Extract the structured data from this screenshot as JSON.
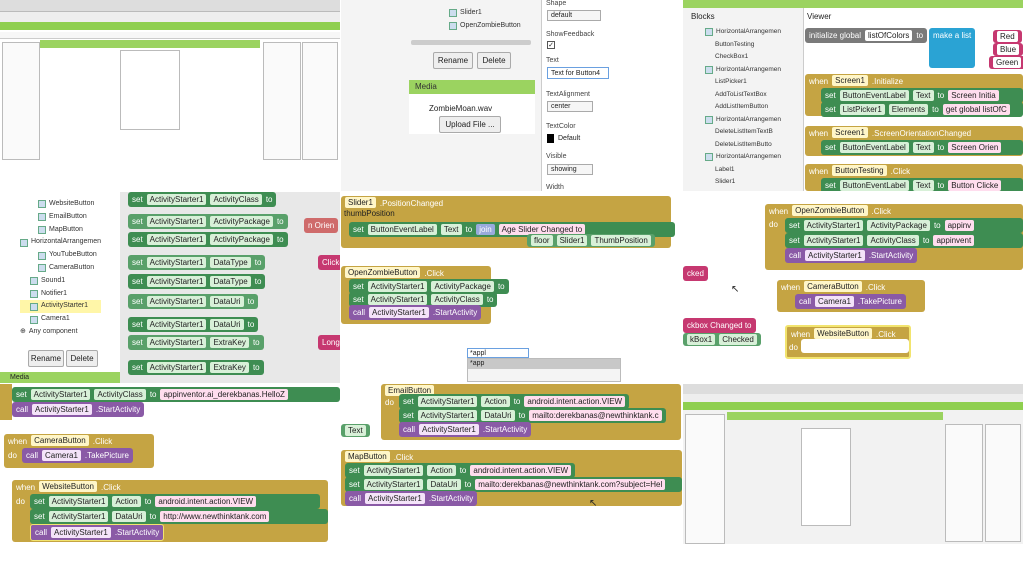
{
  "cell2": {
    "tree_items": [
      "Slider1",
      "OpenZombieButton"
    ],
    "rename": "Rename",
    "delete": "Delete",
    "media_title": "Media",
    "media_file": "ZombieMoan.wav",
    "upload": "Upload File ...",
    "props": {
      "shape_label": "Shape",
      "shape_value": "default",
      "show_feedback": "ShowFeedback",
      "text_label": "Text",
      "text_value": "Text for Button4",
      "align_label": "TextAlignment",
      "align_value": "center",
      "color_label": "TextColor",
      "color_value": "Default",
      "visible_label": "Visible",
      "visible_value": "showing",
      "width_label": "Width"
    }
  },
  "cell3": {
    "blocks_title": "Blocks",
    "viewer_title": "Viewer",
    "tree": [
      "HorizontalArrangemen",
      "ButtonTesting",
      "CheckBox1",
      "HorizontalArrangemen",
      "ListPicker1",
      "AddToListTextBox",
      "AddListItemButton",
      "HorizontalArrangemen",
      "DeleteListItemTextB",
      "DeleteListItemButto",
      "HorizontalArrangemen",
      "Label1",
      "Slider1"
    ],
    "init": {
      "a": "initialize global",
      "b": "listOfColors",
      "c": "to",
      "d": "make a list",
      "e": [
        "Red",
        "Blue",
        "Green"
      ]
    },
    "ev1": {
      "when": "when",
      "comp": "Screen1",
      "ev": ".Initialize"
    },
    "set1": {
      "set": "set",
      "comp": "ButtonEventLabel",
      "prop": "Text",
      "to": "to",
      "val": "Screen Initia"
    },
    "set2": {
      "set": "set",
      "comp": "ListPicker1",
      "prop": "Elements",
      "to": "to",
      "val": "get global listOfC"
    },
    "ev2": {
      "when": "when",
      "comp": "Screen1",
      "ev": ".ScreenOrientationChanged"
    },
    "set3": {
      "set": "set",
      "comp": "ButtonEventLabel",
      "prop": "Text",
      "to": "to",
      "val": "Screen Orien"
    },
    "ev3": {
      "when": "when",
      "comp": "ButtonTesting",
      "ev": ".Click"
    },
    "set4": {
      "set": "set",
      "comp": "ButtonEventLabel",
      "prop": "Text",
      "to": "to",
      "val": "Button Clicke"
    },
    "do": "do"
  },
  "cell4": {
    "tree": [
      "WebsiteButton",
      "EmailButton",
      "MapButton",
      "HorizontalArrangemen",
      "YouTubeButton",
      "CameraButton",
      "Sound1",
      "Notifier1",
      "ActivityStarter1",
      "Camera1",
      "Any component"
    ],
    "rename": "Rename",
    "delete": "Delete",
    "media": "Media",
    "blocks": [
      {
        "comp": "ActivityStarter1",
        "prop": "ActivityClass"
      },
      {
        "comp": "ActivityStarter1",
        "prop": "ActivityPackage"
      },
      {
        "comp": "ActivityStarter1",
        "prop": "ActivityPackage"
      },
      {
        "comp": "ActivityStarter1",
        "prop": "DataType"
      },
      {
        "comp": "ActivityStarter1",
        "prop": "DataType"
      },
      {
        "comp": "ActivityStarter1",
        "prop": "DataUri"
      },
      {
        "comp": "ActivityStarter1",
        "prop": "DataUri"
      },
      {
        "comp": "ActivityStarter1",
        "prop": "ExtraKey"
      },
      {
        "comp": "ActivityStarter1",
        "prop": "ExtraKey"
      }
    ],
    "tails": [
      "n Orien",
      "Clicke",
      "Long c"
    ]
  },
  "cell5": {
    "ev1": {
      "when": "when",
      "comp": "Slider1",
      "ev": ".PositionChanged"
    },
    "thumb": "thumbPosition",
    "set1": {
      "comp": "ButtonEventLabel",
      "prop": "Text",
      "join": "join",
      "val": "Age Slider Changed to"
    },
    "floor": {
      "op": "floor",
      "comp": "Slider1",
      "prop": "ThumbPosition"
    },
    "ev2": {
      "when": "when",
      "comp": "OpenZombieButton",
      "ev": ".Click"
    },
    "set2": {
      "comp": "ActivityStarter1",
      "prop": "ActivityPackage"
    },
    "set3": {
      "comp": "ActivityStarter1",
      "prop": "ActivityClass"
    },
    "call": {
      "comp": "ActivityStarter1",
      "m": ".StartActivity"
    },
    "search_value": "*appl",
    "search_suggestion": "*app"
  },
  "cell6": {
    "ev1": {
      "when": "when",
      "comp": "OpenZombieButton",
      "ev": ".Click"
    },
    "set1": {
      "comp": "ActivityStarter1",
      "prop": "ActivityPackage",
      "val": "appinv"
    },
    "set2": {
      "comp": "ActivityStarter1",
      "prop": "ActivityClass",
      "val": "appinvent"
    },
    "call1": {
      "comp": "ActivityStarter1",
      "m": ".StartActivity"
    },
    "ev2": {
      "when": "when",
      "comp": "CameraButton",
      "ev": ".Click"
    },
    "call2": {
      "comp": "Camera1",
      "m": ".TakePicture"
    },
    "ev3": {
      "when": "when",
      "comp": "WebsiteButton",
      "ev": ".Click"
    },
    "do": "do",
    "frag1": "cked",
    "frag2": "ckbox Changed to",
    "frag3": "kBox1",
    "frag4": "Checked"
  },
  "cell7": {
    "set0": {
      "comp": "ActivityStarter1",
      "prop": "ActivityClass",
      "val": "appinventor.ai_derekbanas.HelloZ"
    },
    "call0": {
      "comp": "ActivityStarter1",
      "m": ".StartActivity"
    },
    "ev1": {
      "when": "when",
      "comp": "CameraButton",
      "ev": ".Click"
    },
    "call1": {
      "comp": "Camera1",
      "m": ".TakePicture"
    },
    "ev2": {
      "when": "when",
      "comp": "WebsiteButton",
      "ev": ".Click"
    },
    "set1": {
      "comp": "ActivityStarter1",
      "prop": "Action",
      "val": "android.intent.action.VIEW"
    },
    "set2": {
      "comp": "ActivityStarter1",
      "prop": "DataUri",
      "val": "http://www.newthinktank.com"
    },
    "call2": {
      "comp": "ActivityStarter1",
      "m": ".StartActivity"
    }
  },
  "cell8": {
    "ev0": {
      "comp": "EmailButton"
    },
    "set1": {
      "comp": "ActivityStarter1",
      "prop": "Action",
      "val": "android.intent.action.VIEW"
    },
    "set2": {
      "comp": "ActivityStarter1",
      "prop": "DataUri",
      "val": "mailto:derekbanas@newthinktank.c"
    },
    "call1": {
      "comp": "ActivityStarter1",
      "m": ".StartActivity"
    },
    "ev1": {
      "when": "when",
      "comp": "MapButton",
      "ev": ".Click"
    },
    "set3": {
      "comp": "ActivityStarter1",
      "prop": "Action",
      "val": "android.intent.action.VIEW"
    },
    "set4": {
      "comp": "ActivityStarter1",
      "prop": "DataUri",
      "val": "mailto:derekbanas@newthinktank.com?subject=Hel"
    },
    "call2": {
      "comp": "ActivityStarter1",
      "m": ".StartActivity"
    },
    "text_frag": "Text"
  },
  "labels": {
    "set": "set",
    "to": "to",
    "call": "call",
    "do": "do",
    "when": "when"
  }
}
